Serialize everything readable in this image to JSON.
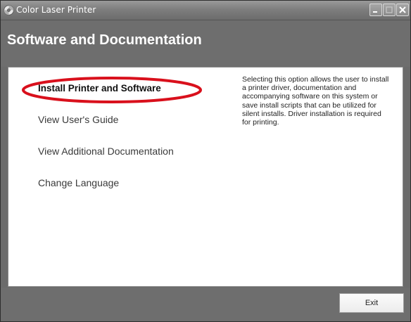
{
  "window": {
    "title": "Color Laser Printer",
    "controls": [
      "minimize-icon",
      "maximize-icon",
      "close-icon"
    ]
  },
  "header": {
    "title": "Software and Documentation"
  },
  "menu": {
    "items": [
      {
        "label": "Install Printer and Software",
        "selected": true
      },
      {
        "label": "View User's Guide",
        "selected": false
      },
      {
        "label": "View Additional Documentation",
        "selected": false
      },
      {
        "label": "Change Language",
        "selected": false
      }
    ]
  },
  "description": {
    "text": "Selecting this option allows the user to install a printer driver, documentation and accompanying software on this system or save install scripts that can be utilized for silent installs. Driver installation is required for printing."
  },
  "footer": {
    "exit_label": "Exit"
  },
  "colors": {
    "titlebar": "#7e7e7e",
    "header_bg": "#6e6e6e",
    "highlight_ring": "#d9101c",
    "content_bg": "#ffffff"
  }
}
